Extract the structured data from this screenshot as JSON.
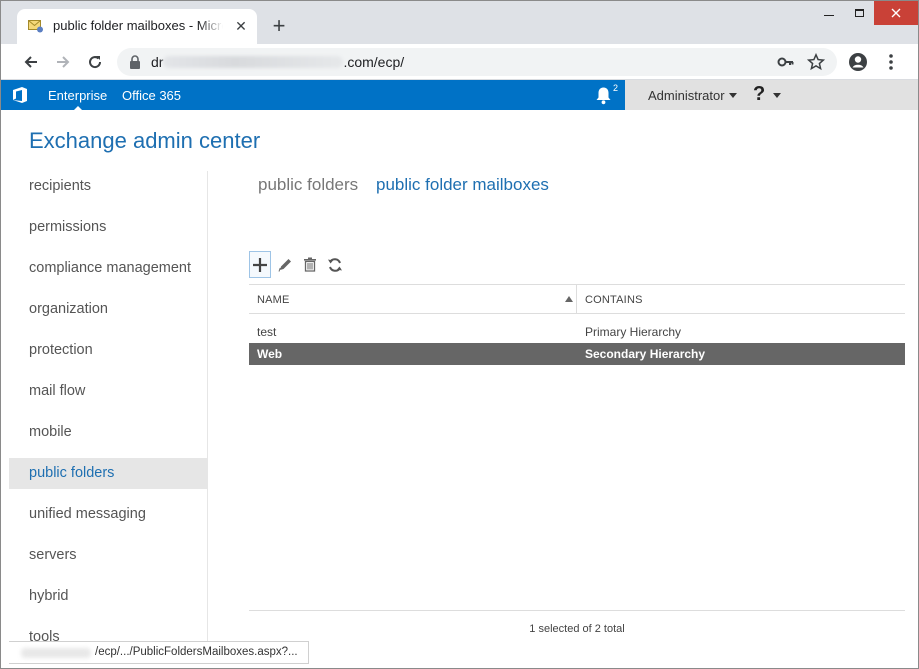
{
  "browser": {
    "tab_title": "public folder mailboxes - Microsoft Exchange",
    "new_tab": "+",
    "tab_close": "✕",
    "url_prefix": "dr",
    "url_suffix": ".com/ecp/"
  },
  "o365": {
    "links": [
      "Enterprise",
      "Office 365"
    ],
    "notifications_count": "2",
    "user": "Administrator",
    "help": "?",
    "accent": "#0072c6"
  },
  "eac": {
    "title": "Exchange admin center",
    "nav": [
      "recipients",
      "permissions",
      "compliance management",
      "organization",
      "protection",
      "mail flow",
      "mobile",
      "public folders",
      "unified messaging",
      "servers",
      "hybrid",
      "tools"
    ],
    "nav_selected": "public folders",
    "subtabs": [
      "public folders",
      "public folder mailboxes"
    ],
    "subtab_active": "public folder mailboxes",
    "toolbar_icons": [
      "add-icon",
      "edit-icon",
      "delete-icon",
      "refresh-icon"
    ],
    "grid": {
      "columns": [
        "NAME",
        "CONTAINS"
      ],
      "rows": [
        {
          "name": "test",
          "contains": "Primary Hierarchy",
          "selected": false
        },
        {
          "name": "Web",
          "contains": "Secondary Hierarchy",
          "selected": true
        }
      ],
      "status": "1 selected of 2 total"
    }
  },
  "status_bar": {
    "url": "/ecp/.../PublicFoldersMailboxes.aspx?..."
  }
}
